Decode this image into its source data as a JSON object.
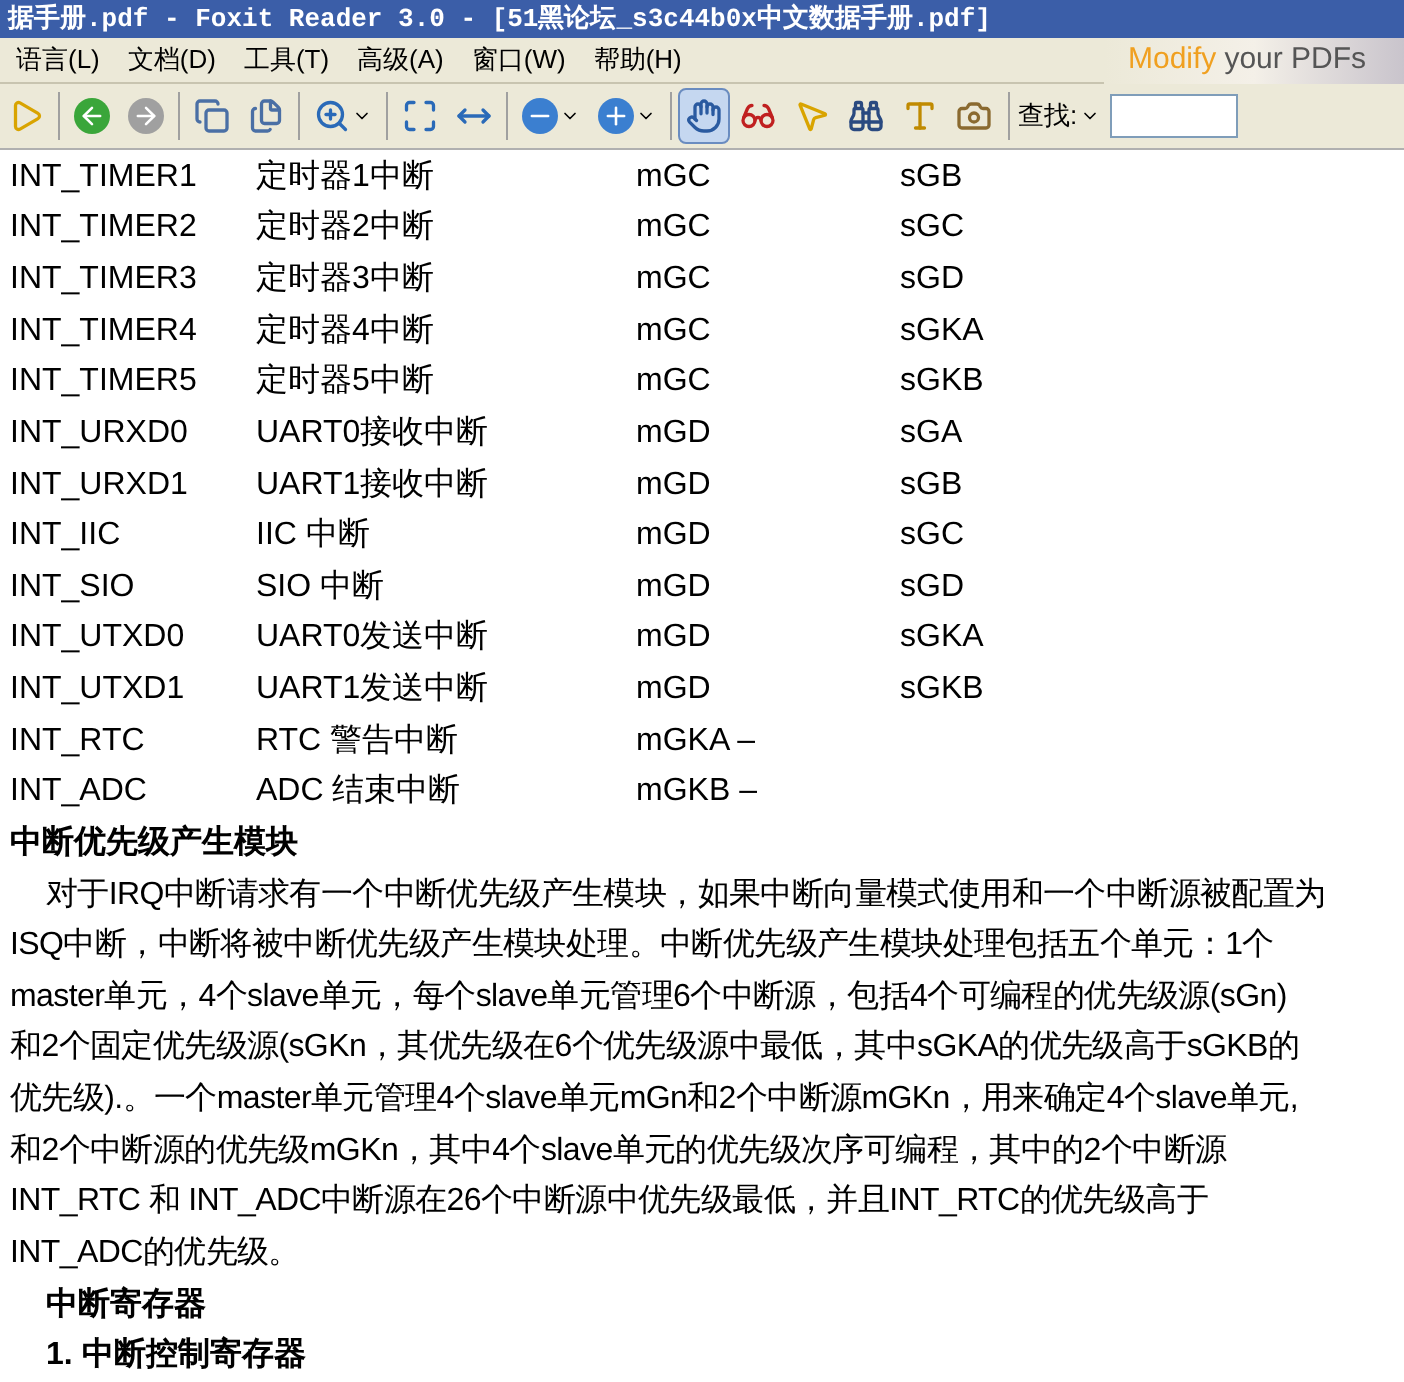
{
  "window": {
    "title": "据手册.pdf - Foxit Reader 3.0 - [51黑论坛_s3c44b0x中文数据手册.pdf]"
  },
  "menu": [
    "语言(L)",
    "文档(D)",
    "工具(T)",
    "高级(A)",
    "窗口(W)",
    "帮助(H)"
  ],
  "banner": {
    "highlight": "Modify",
    "rest": "your PDFs"
  },
  "toolbar": {
    "tools": [
      {
        "kind": "play",
        "selected": false
      },
      {
        "kind": "back",
        "selected": false
      },
      {
        "kind": "forward",
        "selected": false
      },
      {
        "kind": "page-prev",
        "selected": false
      },
      {
        "kind": "page-next",
        "selected": false
      },
      {
        "kind": "zoom-tool",
        "selected": false
      },
      {
        "kind": "fit-page",
        "selected": false
      },
      {
        "kind": "fit-width",
        "selected": false
      },
      {
        "kind": "zoom-out",
        "selected": false
      },
      {
        "kind": "zoom-in",
        "selected": false
      },
      {
        "kind": "hand",
        "selected": true
      },
      {
        "kind": "reader",
        "selected": false
      },
      {
        "kind": "select",
        "selected": false
      },
      {
        "kind": "find",
        "selected": false
      },
      {
        "kind": "text",
        "selected": false
      },
      {
        "kind": "snapshot",
        "selected": false
      }
    ],
    "find_label": "查找:"
  },
  "table": {
    "rows": [
      [
        "INT_TIMER1",
        "定时器1中断",
        "mGC",
        "sGB"
      ],
      [
        "INT_TIMER2",
        "定时器2中断",
        "mGC",
        "sGC"
      ],
      [
        "INT_TIMER3",
        "定时器3中断",
        "mGC",
        "sGD"
      ],
      [
        "INT_TIMER4",
        "定时器4中断",
        "mGC",
        "sGKA"
      ],
      [
        "INT_TIMER5",
        "定时器5中断",
        "mGC",
        "sGKB"
      ],
      [
        "INT_URXD0",
        "UART0接收中断",
        "mGD",
        "sGA"
      ],
      [
        "INT_URXD1",
        "UART1接收中断",
        "mGD",
        "sGB"
      ],
      [
        "INT_IIC",
        "IIC  中断",
        "mGD",
        "sGC"
      ],
      [
        "INT_SIO",
        "SIO  中断",
        "mGD",
        "sGD"
      ],
      [
        "INT_UTXD0",
        "UART0发送中断",
        "mGD",
        "sGKA"
      ],
      [
        "INT_UTXD1",
        "UART1发送中断",
        "mGD",
        "sGKB"
      ],
      [
        "INT_RTC",
        "RTC  警告中断",
        "mGKA –",
        ""
      ],
      [
        "INT_ADC",
        "ADC  结束中断",
        "mGKB –",
        ""
      ]
    ]
  },
  "section": {
    "heading": "中断优先级产生模块",
    "lines": [
      "对于IRQ中断请求有一个中断优先级产生模块，如果中断向量模式使用和一个中断源被配置为",
      "ISQ中断，中断将被中断优先级产生模块处理。中断优先级产生模块处理包括五个单元：1个",
      "master单元，4个slave单元，每个slave单元管理6个中断源，包括4个可编程的优先级源(sGn)",
      "和2个固定优先级源(sGKn，其优先级在6个优先级源中最低，其中sGKA的优先级高于sGKB的",
      "优先级).。一个master单元管理4个slave单元mGn和2个中断源mGKn，用来确定4个slave单元,",
      "和2个中断源的优先级mGKn，其中4个slave单元的优先级次序可编程，其中的2个中断源",
      "INT_RTC  和  INT_ADC中断源在26个中断源中优先级最低，并且INT_RTC的优先级高于",
      "INT_ADC的优先级。"
    ]
  },
  "subheadings": [
    "中断寄存器",
    "1. 中断控制寄存器"
  ]
}
